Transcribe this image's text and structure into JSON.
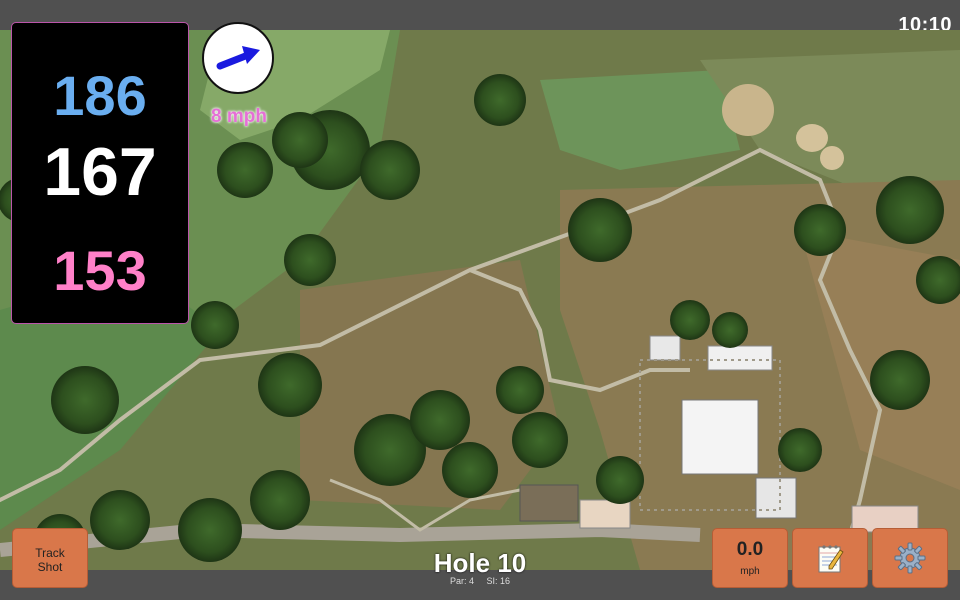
{
  "status_bar": {
    "time": "10:10"
  },
  "yardages": {
    "back": "186",
    "middle": "167",
    "front": "153"
  },
  "wind": {
    "speed_label": "8 mph",
    "icon": "wind-arrow-icon"
  },
  "hole": {
    "title": "Hole 10",
    "par_label": "Par: 4",
    "si_label": "SI: 16"
  },
  "buttons": {
    "track_shot_line1": "Track",
    "track_shot_line2": "Shot",
    "speed_value": "0.0",
    "speed_unit": "mph",
    "notes_icon": "notepad-icon",
    "settings_icon": "gear-icon"
  },
  "colors": {
    "back": "#6aaef0",
    "middle": "#ffffff",
    "front": "#ff80c8",
    "wind": "#e56fd6",
    "button": "#d9774a"
  }
}
